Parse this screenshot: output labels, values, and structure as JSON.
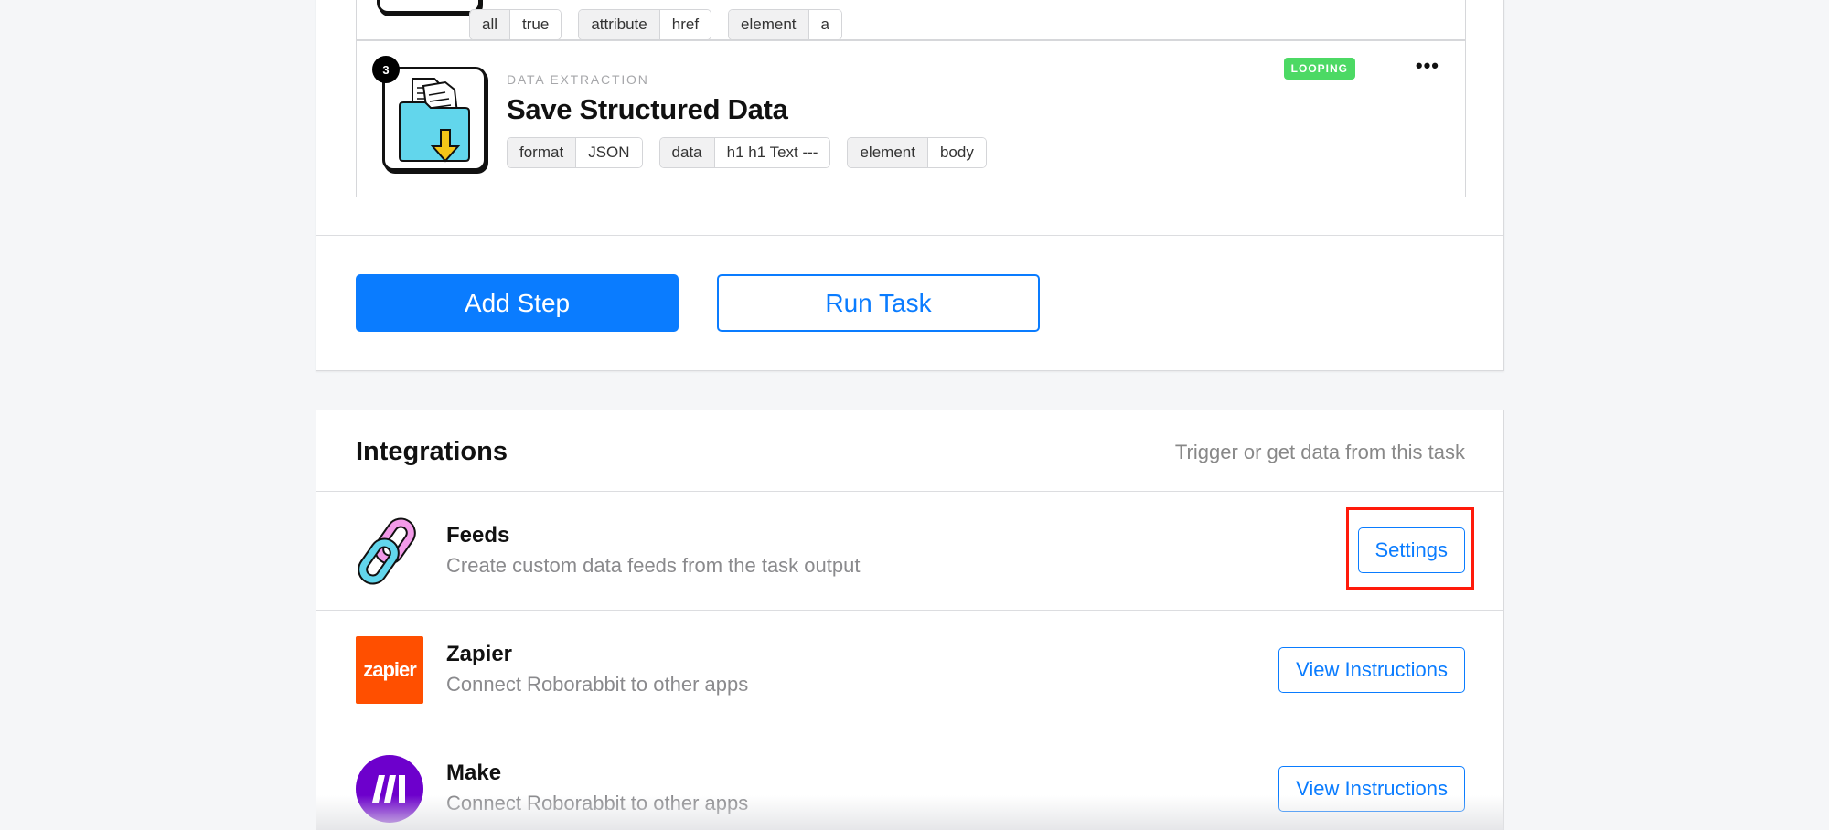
{
  "previous_step": {
    "tags": [
      {
        "key": "all",
        "value": "true"
      },
      {
        "key": "attribute",
        "value": "href"
      },
      {
        "key": "element",
        "value": "a"
      }
    ]
  },
  "step": {
    "number": "3",
    "category": "DATA EXTRACTION",
    "title": "Save Structured Data",
    "badge": "LOOPING",
    "more_label": "•••",
    "icon": "folder-download-icon",
    "tags": [
      {
        "key": "format",
        "value": "JSON"
      },
      {
        "key": "data",
        "value": "h1 h1 Text ---"
      },
      {
        "key": "element",
        "value": "body"
      }
    ]
  },
  "actions": {
    "add_step": "Add Step",
    "run_task": "Run Task"
  },
  "integrations": {
    "title": "Integrations",
    "subtitle": "Trigger or get data from this task",
    "items": [
      {
        "name": "Feeds",
        "description": "Create custom data feeds from the task output",
        "button": "Settings",
        "icon": "chain-link-icon",
        "highlighted": true
      },
      {
        "name": "Zapier",
        "description": "Connect Roborabbit to other apps",
        "button": "View Instructions",
        "icon": "zapier-logo",
        "logo_text": "zapier"
      },
      {
        "name": "Make",
        "description": "Connect Roborabbit to other apps",
        "button": "View Instructions",
        "icon": "make-logo"
      }
    ]
  },
  "colors": {
    "primary": "#0a7cff",
    "badge_green": "#4cd964",
    "highlight_red": "#ff1a0a",
    "zapier_orange": "#ff4f00",
    "make_purple": "#6d00cc"
  }
}
